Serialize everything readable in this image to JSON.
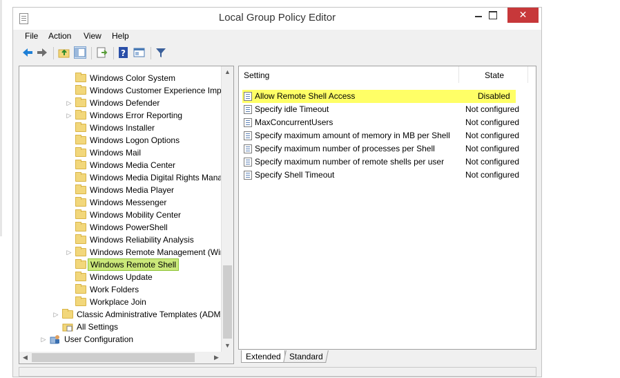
{
  "window": {
    "title": "Local Group Policy Editor",
    "close_glyph": "✕"
  },
  "menu": [
    "File",
    "Action",
    "View",
    "Help"
  ],
  "toolbar": [
    {
      "icon": "back-arrow-icon",
      "color": "#1e7fd6"
    },
    {
      "icon": "forward-arrow-icon",
      "color": "#6e6e6e"
    },
    {
      "icon": "up-folder-icon",
      "color": "#e0b84a"
    },
    {
      "icon": "show-hide-tree-icon",
      "color": "#4a7ab5"
    },
    {
      "icon": "export-list-icon",
      "color": "#5a9e3a"
    },
    {
      "icon": "help-icon",
      "color": "#2a4fa8"
    },
    {
      "icon": "properties-icon",
      "color": "#4a7ab5"
    },
    {
      "icon": "filter-icon",
      "color": "#3a5f9a"
    }
  ],
  "tree": [
    {
      "label": "Windows Color System",
      "level": 3,
      "expander": false
    },
    {
      "label": "Windows Customer Experience Impro",
      "level": 3,
      "expander": false
    },
    {
      "label": "Windows Defender",
      "level": 3,
      "expander": true
    },
    {
      "label": "Windows Error Reporting",
      "level": 3,
      "expander": true
    },
    {
      "label": "Windows Installer",
      "level": 3,
      "expander": false
    },
    {
      "label": "Windows Logon Options",
      "level": 3,
      "expander": false
    },
    {
      "label": "Windows Mail",
      "level": 3,
      "expander": false
    },
    {
      "label": "Windows Media Center",
      "level": 3,
      "expander": false
    },
    {
      "label": "Windows Media Digital Rights Manag",
      "level": 3,
      "expander": false
    },
    {
      "label": "Windows Media Player",
      "level": 3,
      "expander": false
    },
    {
      "label": "Windows Messenger",
      "level": 3,
      "expander": false
    },
    {
      "label": "Windows Mobility Center",
      "level": 3,
      "expander": false
    },
    {
      "label": "Windows PowerShell",
      "level": 3,
      "expander": false
    },
    {
      "label": "Windows Reliability Analysis",
      "level": 3,
      "expander": false
    },
    {
      "label": "Windows Remote Management (Win",
      "level": 3,
      "expander": true
    },
    {
      "label": "Windows Remote Shell",
      "level": 3,
      "expander": false,
      "selected": true
    },
    {
      "label": "Windows Update",
      "level": 3,
      "expander": false
    },
    {
      "label": "Work Folders",
      "level": 3,
      "expander": false
    },
    {
      "label": "Workplace Join",
      "level": 3,
      "expander": false
    },
    {
      "label": "Classic Administrative Templates (ADM)",
      "level": 2,
      "expander": true
    },
    {
      "label": "All Settings",
      "level": 2,
      "expander": false,
      "icon": "all-settings-icon"
    },
    {
      "label": "User Configuration",
      "level": 1,
      "expander": true,
      "icon": "user-config-icon"
    }
  ],
  "list": {
    "headers": {
      "setting": "Setting",
      "state": "State"
    },
    "rows": [
      {
        "name": "Allow Remote Shell Access",
        "state": "Disabled",
        "highlight": true
      },
      {
        "name": "Specify idle Timeout",
        "state": "Not configured"
      },
      {
        "name": "MaxConcurrentUsers",
        "state": "Not configured"
      },
      {
        "name": "Specify maximum amount of memory in MB per Shell",
        "state": "Not configured"
      },
      {
        "name": "Specify maximum number of processes per Shell",
        "state": "Not configured"
      },
      {
        "name": "Specify maximum number of remote shells per user",
        "state": "Not configured"
      },
      {
        "name": "Specify Shell Timeout",
        "state": "Not configured"
      }
    ]
  },
  "tabs": {
    "extended": "Extended",
    "standard": "Standard"
  },
  "colors": {
    "highlight": "#ffff66",
    "selection": "#cbe87a",
    "close": "#c7383a"
  }
}
